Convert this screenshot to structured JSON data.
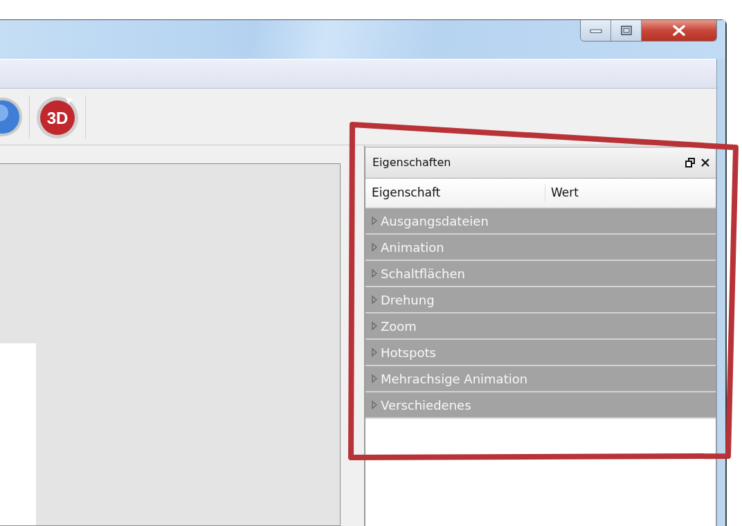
{
  "toolbar": {
    "buttons": [
      {
        "kind": "globe"
      },
      {
        "kind": "badge3d",
        "label": "3D"
      }
    ]
  },
  "properties_panel": {
    "title": "Eigenschaften",
    "columns": [
      "Eigenschaft",
      "Wert"
    ],
    "categories": [
      {
        "label": "Ausgangsdateien",
        "expanded": false
      },
      {
        "label": "Animation",
        "expanded": false
      },
      {
        "label": "Schaltflächen",
        "expanded": false
      },
      {
        "label": "Drehung",
        "expanded": false
      },
      {
        "label": "Zoom",
        "expanded": false
      },
      {
        "label": "Hotspots",
        "expanded": false
      },
      {
        "label": "Mehrachsige Animation",
        "expanded": false
      },
      {
        "label": "Verschiedenes",
        "expanded": false
      }
    ]
  }
}
